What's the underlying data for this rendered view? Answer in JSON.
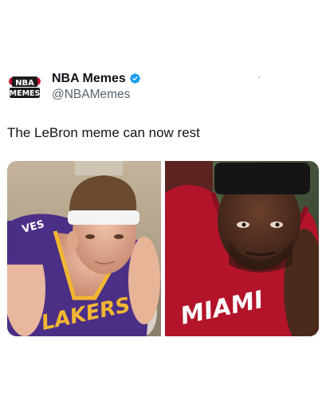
{
  "account": {
    "display_name": "NBA Memes",
    "handle": "@NBAMemes",
    "verified": true,
    "avatar_text_top": "NBA",
    "avatar_text_bottom": "MEMES"
  },
  "tweet": {
    "text": "The LeBron meme can now rest"
  },
  "media": {
    "left_photo": {
      "jersey_text": "LAKERS",
      "shoulder_text": "VES",
      "jersey_color": "#4b2f86"
    },
    "right_photo": {
      "jersey_text": "MIAMI",
      "jersey_color": "#b3142a"
    }
  },
  "colors": {
    "verified_blue": "#1d9bf0",
    "handle_gray": "#536471",
    "text": "#0f1419"
  }
}
